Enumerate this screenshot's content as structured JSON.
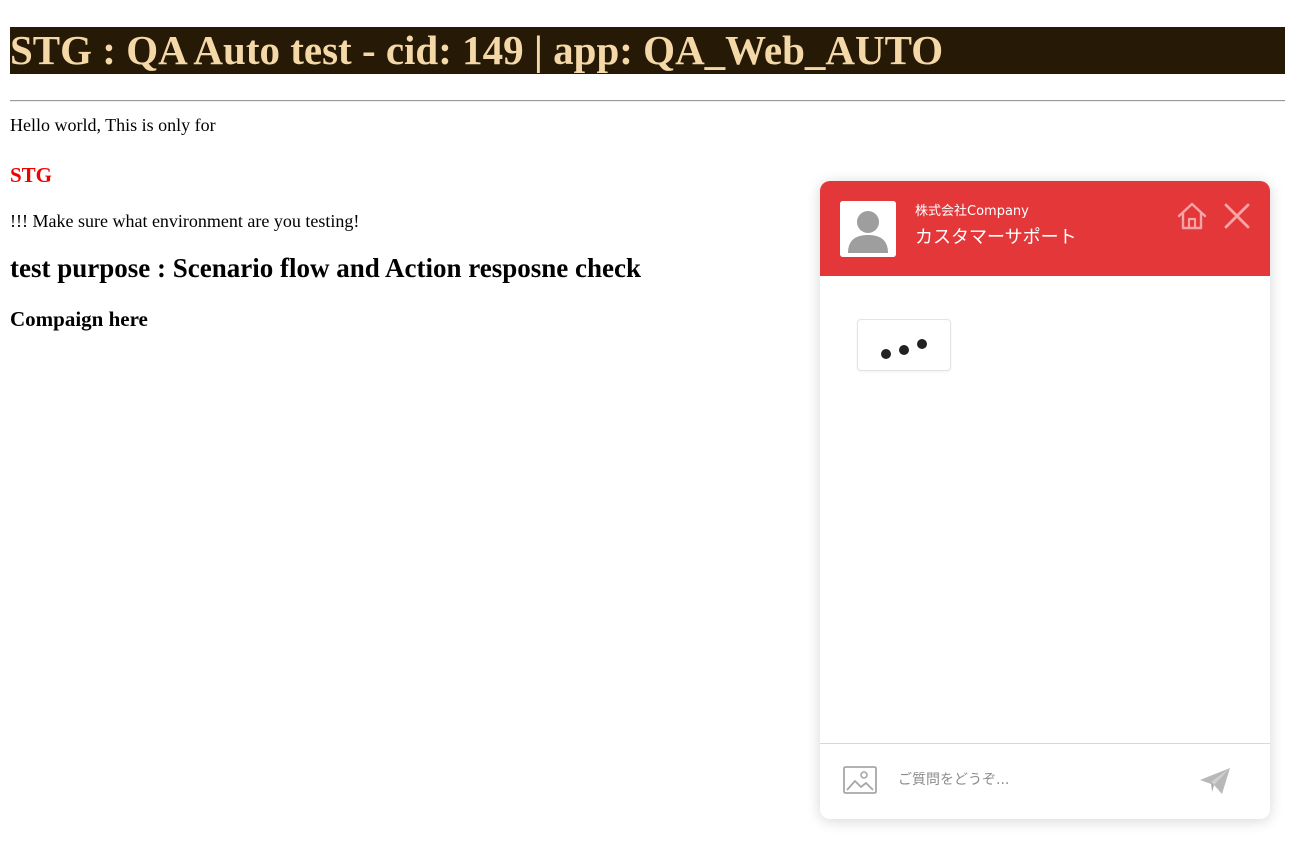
{
  "page": {
    "banner": "STG : QA Auto test - cid: 149 | app: QA_Web_AUTO",
    "hello": "Hello world, This is only for",
    "environment": "STG",
    "warning": "!!! Make sure what environment are you testing!",
    "purpose": "test purpose : Scenario flow and Action resposne check",
    "campaign": "Compaign here"
  },
  "chat": {
    "company": "株式会社Company",
    "title": "カスタマーサポート",
    "input_placeholder": "ご質問をどうぞ...",
    "icons": {
      "avatar": "user-avatar-icon",
      "home": "home-icon",
      "close": "close-icon",
      "typing": "typing-indicator",
      "image": "image-upload-icon",
      "send": "send-icon"
    }
  },
  "colors": {
    "banner_bg": "#261a07",
    "banner_text": "#f5d8a8",
    "env_text": "#f00000",
    "chat_header": "#e4373a"
  }
}
